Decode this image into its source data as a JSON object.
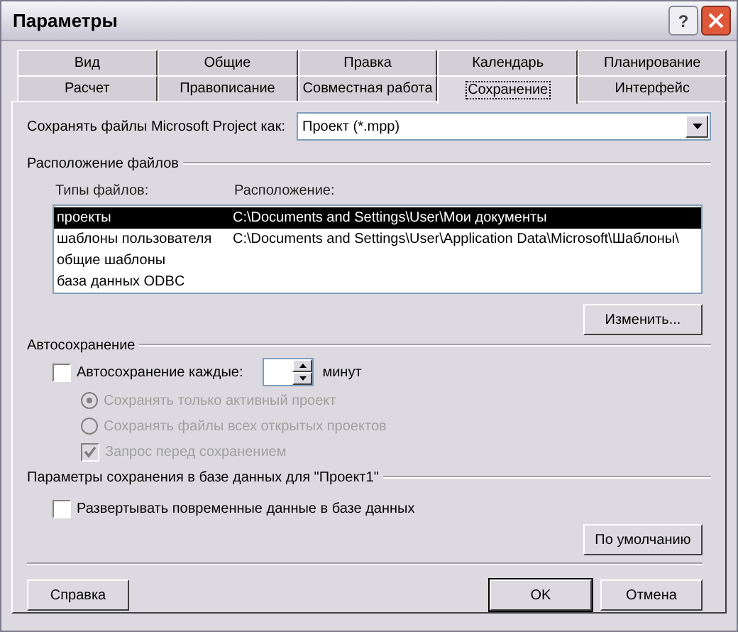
{
  "window": {
    "title": "Параметры",
    "help": "?"
  },
  "tabs": [
    [
      {
        "label": "Вид",
        "selected": false
      },
      {
        "label": "Общие",
        "selected": false
      },
      {
        "label": "Правка",
        "selected": false
      },
      {
        "label": "Календарь",
        "selected": false
      },
      {
        "label": "Планирование",
        "selected": false
      }
    ],
    [
      {
        "label": "Расчет",
        "selected": false
      },
      {
        "label": "Правописание",
        "selected": false
      },
      {
        "label": "Совместная работа",
        "selected": false
      },
      {
        "label": "Сохранение",
        "selected": true
      },
      {
        "label": "Интерфейс",
        "selected": false
      }
    ]
  ],
  "save_as": {
    "label": "Сохранять файлы Microsoft Project как:",
    "value": "Проект (*.mpp)"
  },
  "file_locations": {
    "title": "Расположение файлов",
    "columns": [
      "Типы файлов:",
      "Расположение:"
    ],
    "rows": [
      {
        "type": "проекты",
        "location": "C:\\Documents and Settings\\User\\Мои документы",
        "selected": true
      },
      {
        "type": "шаблоны пользователя",
        "location": "C:\\Documents and Settings\\User\\Application Data\\Microsoft\\Шаблоны\\",
        "selected": false
      },
      {
        "type": "общие шаблоны",
        "location": "",
        "selected": false
      },
      {
        "type": "база данных ODBC",
        "location": "",
        "selected": false
      }
    ],
    "button": "Изменить..."
  },
  "autosave": {
    "title": "Автосохранение",
    "checkbox": {
      "label": "Автосохранение каждые:",
      "checked": false
    },
    "unit": "минут",
    "options": [
      {
        "kind": "radio",
        "label": "Сохранять только активный проект",
        "checked": true,
        "disabled": true
      },
      {
        "kind": "radio",
        "label": "Сохранять файлы всех открытых проектов",
        "checked": false,
        "disabled": true
      },
      {
        "kind": "checkbox",
        "label": "Запрос перед сохранением",
        "checked": true,
        "disabled": true
      }
    ]
  },
  "database": {
    "title": "Параметры сохранения в базе данных для \"Проект1\"",
    "checkbox": {
      "label": "Развертывать повременные данные в базе данных",
      "checked": false
    },
    "button": "По умолчанию"
  },
  "buttons": [
    {
      "label": "Справка",
      "default": false
    },
    {
      "label": "OK",
      "default": true
    },
    {
      "label": "Отмена",
      "default": false
    }
  ]
}
